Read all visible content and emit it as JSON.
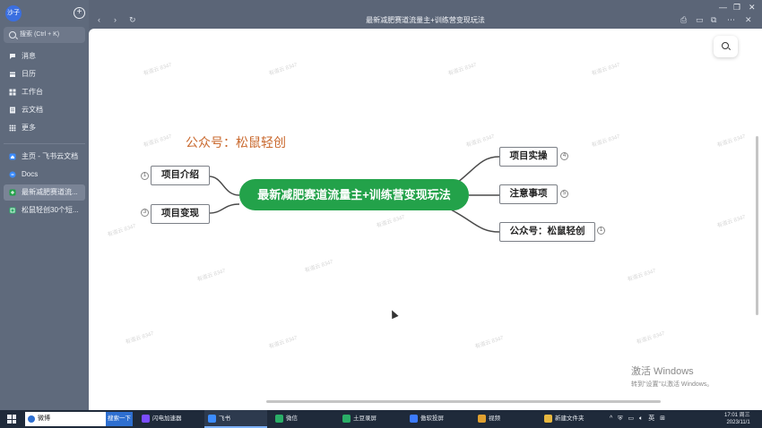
{
  "sidebar": {
    "avatar": "沙子",
    "search_placeholder": "搜索 (Ctrl + K)",
    "nav": [
      {
        "label": "消息",
        "icon": "chat-icon"
      },
      {
        "label": "日历",
        "icon": "calendar-icon"
      },
      {
        "label": "工作台",
        "icon": "grid-icon"
      },
      {
        "label": "云文档",
        "icon": "doc-icon"
      },
      {
        "label": "更多",
        "icon": "more-icon"
      }
    ],
    "recent": [
      {
        "label": "主页 - 飞书云文档",
        "icon": "home-icon"
      },
      {
        "label": "Docs",
        "icon": "docs-icon"
      },
      {
        "label": "最新减肥赛道流...",
        "icon": "mindmap-icon",
        "active": true
      },
      {
        "label": "松鼠轻创30个短...",
        "icon": "sheet-icon"
      }
    ]
  },
  "window": {
    "title": "最新减肥赛道流量主+训练营变现玩法"
  },
  "mindmap": {
    "center": "最新减肥赛道流量主+训练营变现玩法",
    "header_label": "公众号：松鼠轻创",
    "left": [
      {
        "label": "项目介绍",
        "count": "1"
      },
      {
        "label": "项目变现",
        "count": "3"
      }
    ],
    "right": [
      {
        "label": "项目实操",
        "count": "4"
      },
      {
        "label": "注意事项",
        "count": "5"
      },
      {
        "label": "公众号：松鼠轻创",
        "count": "1"
      }
    ],
    "watermark": "有道云 8347"
  },
  "activation": {
    "line1": "激活 Windows",
    "line2": "转到\"设置\"以激活 Windows。"
  },
  "taskbar": {
    "search_text": "微博",
    "search_button": "搜索一下",
    "tasks": [
      {
        "label": "闪电加速器",
        "color": "#7b4dff"
      },
      {
        "label": "飞书",
        "color": "#3c8cff"
      },
      {
        "label": "微信",
        "color": "#2aae67"
      },
      {
        "label": "土豆录屏",
        "color": "#2aae67"
      },
      {
        "label": "傲软投屏",
        "color": "#3c7bff"
      },
      {
        "label": "视频",
        "color": "#e0a030"
      },
      {
        "label": "新建文件夹",
        "color": "#e8b840"
      }
    ],
    "ime": "英",
    "time": "17:01 周三",
    "date": "2023/11/1"
  },
  "colors": {
    "center_node": "#23a24a",
    "accent_label": "#c9682d"
  }
}
